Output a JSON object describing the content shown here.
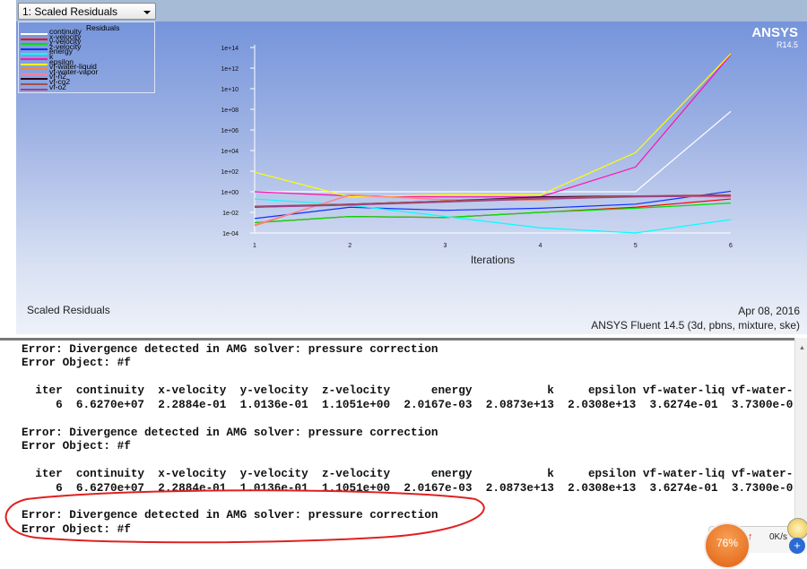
{
  "dropdown": {
    "selected": "1: Scaled Residuals"
  },
  "brand": {
    "name": "ANSYS",
    "version": "R14.5"
  },
  "chart_data": {
    "type": "line",
    "title": "Residuals",
    "xlabel": "Iterations",
    "ylabel": "",
    "yscale": "log",
    "x": [
      1,
      2,
      3,
      4,
      5,
      6
    ],
    "xticks": [
      "1",
      "2",
      "3",
      "4",
      "5",
      "6"
    ],
    "yticks": [
      "1e+14",
      "1e+12",
      "1e+10",
      "1e+08",
      "1e+06",
      "1e+04",
      "1e+02",
      "1e+00",
      "1e-02",
      "1e-04"
    ],
    "ylim_log10": [
      -4,
      14
    ],
    "legend_position": "top-left",
    "series": [
      {
        "name": "continuity",
        "color": "#ffffff",
        "log10": [
          0,
          0,
          0,
          0,
          0,
          7.8
        ]
      },
      {
        "name": "x-velocity",
        "color": "#ff0000",
        "log10": [
          -3,
          -2.4,
          -2.5,
          -2,
          -1.5,
          -0.7
        ]
      },
      {
        "name": "y-velocity",
        "color": "#00e000",
        "log10": [
          -3,
          -2.4,
          -2.5,
          -2,
          -1.6,
          -1.1
        ]
      },
      {
        "name": "z-velocity",
        "color": "#1030ff",
        "log10": [
          -2.6,
          -1.5,
          -1.8,
          -1.6,
          -1.2,
          0.05
        ]
      },
      {
        "name": "energy",
        "color": "#00ffff",
        "log10": [
          -0.7,
          -1.3,
          -2.4,
          -3.5,
          -4,
          -2.7
        ]
      },
      {
        "name": "k",
        "color": "#ff10b0",
        "log10": [
          0,
          -0.4,
          -0.5,
          -0.5,
          2.4,
          13.3
        ]
      },
      {
        "name": "epsilon",
        "color": "#ffff00",
        "log10": [
          1.9,
          -0.5,
          -0.3,
          -0.3,
          3.8,
          13.4
        ]
      },
      {
        "name": "vf-water-liquid",
        "color": "#ff8030",
        "log10": [
          -3.3,
          -0.3,
          -0.8,
          -0.8,
          -0.4,
          -0.5
        ]
      },
      {
        "name": "vf-water-vapor",
        "color": "#ff80a0",
        "log10": [
          -3.2,
          -0.35,
          -0.75,
          -0.75,
          -0.45,
          -0.5
        ]
      },
      {
        "name": "vf-n2",
        "color": "#300020",
        "log10": [
          -1.5,
          -1.2,
          -0.9,
          -0.5,
          -0.4,
          -0.4
        ]
      },
      {
        "name": "vf-co2",
        "color": "#a05050",
        "log10": [
          -1.4,
          -1.2,
          -0.9,
          -0.6,
          -0.4,
          -0.3
        ]
      },
      {
        "name": "vf-o2",
        "color": "#a04090",
        "log10": [
          -1.5,
          -1.3,
          -1.0,
          -0.7,
          -0.5,
          -0.4
        ]
      }
    ]
  },
  "footer": {
    "left": "Scaled Residuals",
    "date": "Apr 08, 2016",
    "product": "ANSYS Fluent 14.5 (3d, pbns, mixture, ske)"
  },
  "console": {
    "lines": [
      "Error: Divergence detected in AMG solver: pressure correction",
      "Error Object: #f",
      "",
      "  iter  continuity  x-velocity  y-velocity  z-velocity      energy           k     epsilon vf-water-liq vf-water-",
      "     6  6.6270e+07  2.2884e-01  1.0136e-01  1.1051e+00  2.0167e-03  2.0873e+13  2.0308e+13  3.6274e-01  3.7300e-0",
      "",
      "Error: Divergence detected in AMG solver: pressure correction",
      "Error Object: #f",
      "",
      "  iter  continuity  x-velocity  y-velocity  z-velocity      energy           k     epsilon vf-water-liq vf-water-",
      "     6  6.6270e+07  2.2884e-01  1.0136e-01  1.1051e+00  2.0167e-03  2.0873e+13  2.0308e+13  3.6274e-01  3.7300e-0",
      "",
      "Error: Divergence detected in AMG solver: pressure correction",
      "Error Object: #f"
    ]
  },
  "tray": {
    "cpu_percent": "76%",
    "net_speed": "0K/s",
    "plus": "+",
    "up_arrow": "↑"
  }
}
